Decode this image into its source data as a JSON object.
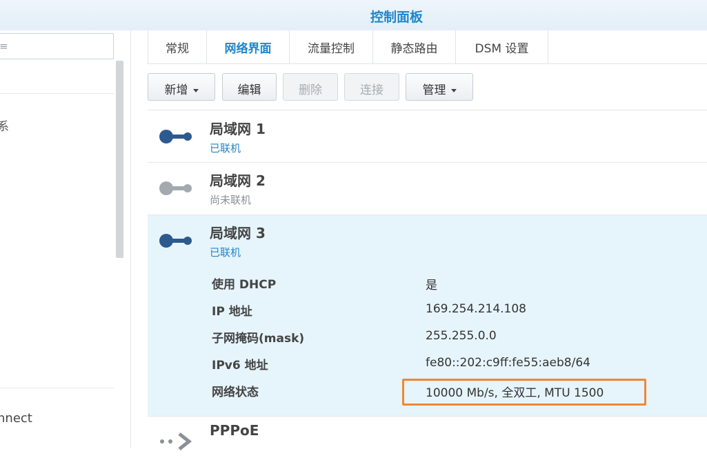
{
  "window": {
    "title": "控制面板"
  },
  "sidebar": {
    "search_placeholder": "≡",
    "fragment_text": "系",
    "bottom_item": "nnect"
  },
  "tabs": [
    "常规",
    "网络界面",
    "流量控制",
    "静态路由",
    "DSM 设置"
  ],
  "toolbar": {
    "add": "新增",
    "edit": "编辑",
    "delete": "删除",
    "connect": "连接",
    "manage": "管理"
  },
  "interfaces": [
    {
      "name": "局域网 1",
      "status": "已联机",
      "connected": true
    },
    {
      "name": "局域网 2",
      "status": "尚未联机",
      "connected": false
    },
    {
      "name": "局域网 3",
      "status": "已联机",
      "connected": true
    },
    {
      "name": "PPPoE",
      "status": "",
      "connected": false
    }
  ],
  "details": {
    "dhcp_label": "使用 DHCP",
    "dhcp_value": "是",
    "ip_label": "IP 地址",
    "ip_value": "169.254.214.108",
    "mask_label": "子网掩码(mask)",
    "mask_value": "255.255.0.0",
    "ipv6_label": "IPv6 地址",
    "ipv6_value": "fe80::202:c9ff:fe55:aeb8/64",
    "net_label": "网络状态",
    "net_value": "10000 Mb/s, 全双工, MTU 1500"
  },
  "colors": {
    "accent": "#1f86c9",
    "connected_icon": "#2d5a8e",
    "disconnected_icon": "#a3a9af",
    "highlight_box": "#ee8733",
    "selected_row": "#e6f4fc"
  }
}
